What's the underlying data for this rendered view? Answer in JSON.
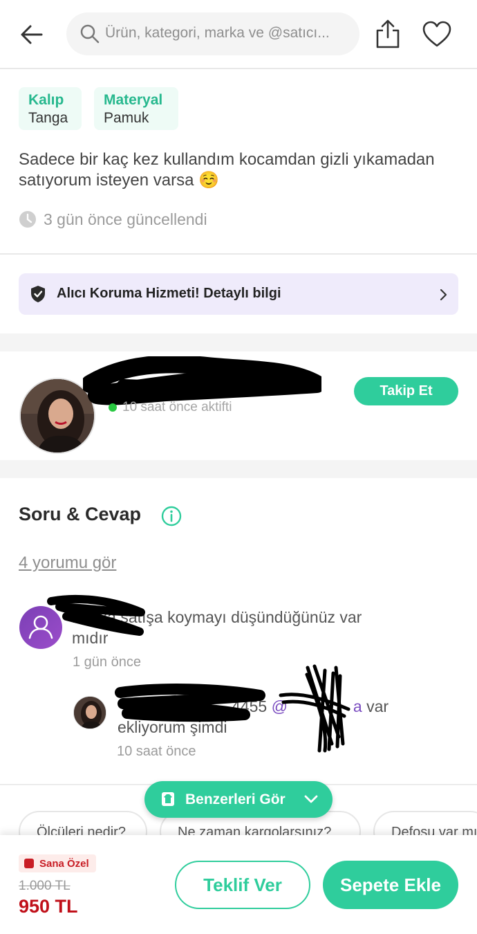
{
  "header": {
    "search_placeholder": "Ürün, kategori, marka ve @satıcı..."
  },
  "attributes": [
    {
      "key": "Kalıp",
      "value": "Tanga"
    },
    {
      "key": "Materyal",
      "value": "Pamuk"
    }
  ],
  "description": "Sadece bir kaç kez kullandım kocamdan gizli yıkamadan satıyorum isteyen varsa ☺️",
  "updated_text": "3 gün önce güncellendi",
  "protection": {
    "label": "Alıcı Koruma Hizmeti! Detaylı bilgi"
  },
  "seller": {
    "status": "10 saat önce aktifti",
    "follow_label": "Takip Et"
  },
  "qa": {
    "title": "Soru & Cevap",
    "see_comments": "4 yorumu gör",
    "question": {
      "text": "Başka satışa koymayı düşündüğünüz var mıdır",
      "time": "1 gün önce"
    },
    "answer": {
      "text_prefix": "4455",
      "mention": "@",
      "mention_tail": "a",
      "text_suffix": "var ekliyorum şimdi",
      "time": "10 saat önce"
    }
  },
  "similar_button": "Benzerleri Gör",
  "question_chips": [
    "Ölçüleri nedir?",
    "Ne zaman kargolarsınız?",
    "Defosu var mı?"
  ],
  "bottom": {
    "badge": "Sana Özel",
    "old_price": "1.000 TL",
    "new_price": "950 TL",
    "offer_label": "Teklif Ver",
    "cart_label": "Sepete Ekle"
  },
  "colors": {
    "accent": "#2fcd9c",
    "price_red": "#c0101a",
    "protect_bg": "#efebfb"
  }
}
